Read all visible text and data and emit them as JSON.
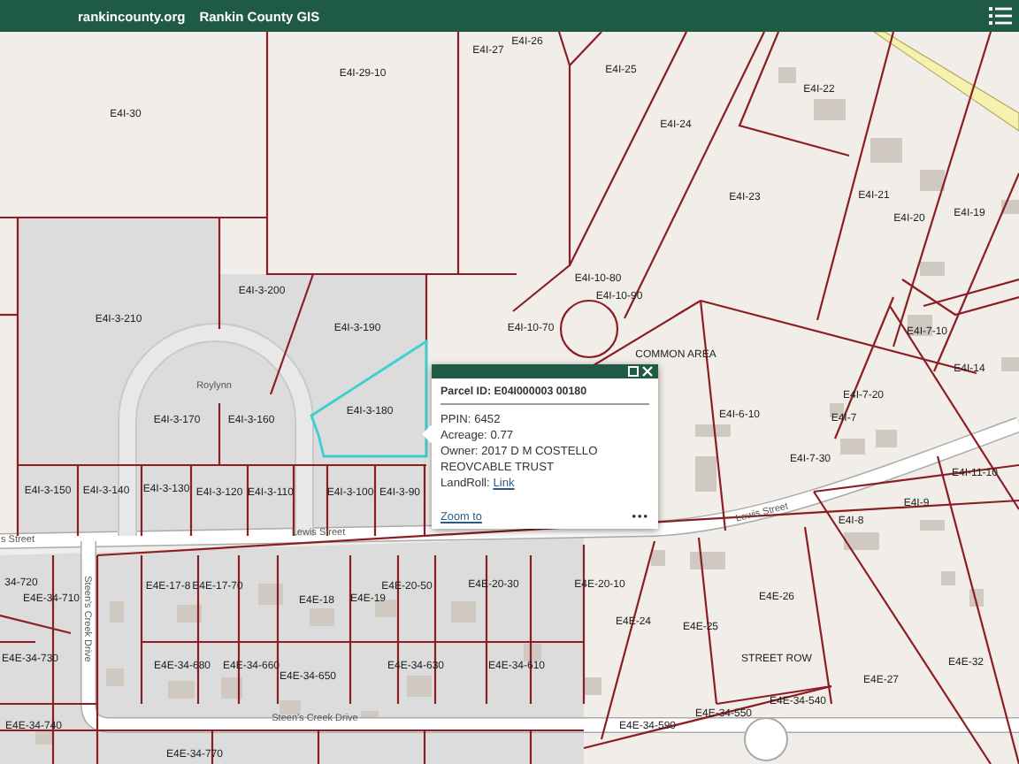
{
  "header": {
    "site": "rankincounty.org",
    "title": "Rankin County GIS"
  },
  "map": {
    "labels": [
      {
        "text": "E4I-30",
        "kind": "parcel"
      },
      {
        "text": "E4I-29-10",
        "kind": "parcel"
      },
      {
        "text": "E4I-27",
        "kind": "parcel"
      },
      {
        "text": "E4I-26",
        "kind": "parcel"
      },
      {
        "text": "E4I-25",
        "kind": "parcel"
      },
      {
        "text": "E4I-24",
        "kind": "parcel"
      },
      {
        "text": "E4I-22",
        "kind": "parcel"
      },
      {
        "text": "E4I-23",
        "kind": "parcel"
      },
      {
        "text": "E4I-21",
        "kind": "parcel"
      },
      {
        "text": "E4I-20",
        "kind": "parcel"
      },
      {
        "text": "E4I-19",
        "kind": "parcel"
      },
      {
        "text": "E4I-10-80",
        "kind": "parcel"
      },
      {
        "text": "E4I-10-90",
        "kind": "parcel"
      },
      {
        "text": "E4I-10-70",
        "kind": "parcel"
      },
      {
        "text": "COMMON AREA",
        "kind": "parcel"
      },
      {
        "text": "E4I-7-10",
        "kind": "parcel"
      },
      {
        "text": "E4I-14",
        "kind": "parcel"
      },
      {
        "text": "E4I-3-200",
        "kind": "parcel"
      },
      {
        "text": "E4I-3-210",
        "kind": "parcel"
      },
      {
        "text": "E4I-3-190",
        "kind": "parcel"
      },
      {
        "text": "Roylynn",
        "kind": "street"
      },
      {
        "text": "E4I-3-170",
        "kind": "parcel"
      },
      {
        "text": "E4I-3-160",
        "kind": "parcel"
      },
      {
        "text": "E4I-3-180",
        "kind": "parcel"
      },
      {
        "text": "E4I-3-150",
        "kind": "parcel"
      },
      {
        "text": "E4I-3-140",
        "kind": "parcel"
      },
      {
        "text": "E4I-3-130",
        "kind": "parcel"
      },
      {
        "text": "E4I-3-120",
        "kind": "parcel"
      },
      {
        "text": "E4I-3-110",
        "kind": "parcel"
      },
      {
        "text": "E4I-3-100",
        "kind": "parcel"
      },
      {
        "text": "E4I-3-90",
        "kind": "parcel"
      },
      {
        "text": "E4I-6-10",
        "kind": "parcel"
      },
      {
        "text": "E4I-7-20",
        "kind": "parcel"
      },
      {
        "text": "E4I-7",
        "kind": "parcel"
      },
      {
        "text": "E4I-7-30",
        "kind": "parcel"
      },
      {
        "text": "E4I-11-10",
        "kind": "parcel"
      },
      {
        "text": "E4I-9",
        "kind": "parcel"
      },
      {
        "text": "E4I-8",
        "kind": "parcel"
      },
      {
        "text": "s Street",
        "kind": "street"
      },
      {
        "text": "Lewis Street",
        "kind": "street"
      },
      {
        "text": "Lewis Street",
        "kind": "street"
      },
      {
        "text": "34-720",
        "kind": "parcel"
      },
      {
        "text": "E4E-34-710",
        "kind": "parcel"
      },
      {
        "text": "E4E-17-8",
        "kind": "parcel"
      },
      {
        "text": "E4E-17-70",
        "kind": "parcel"
      },
      {
        "text": "E4E-18",
        "kind": "parcel"
      },
      {
        "text": "E4E-19",
        "kind": "parcel"
      },
      {
        "text": "E4E-20-50",
        "kind": "parcel"
      },
      {
        "text": "E4E-20-30",
        "kind": "parcel"
      },
      {
        "text": "E4E-20-10",
        "kind": "parcel"
      },
      {
        "text": "E4E-24",
        "kind": "parcel"
      },
      {
        "text": "E4E-25",
        "kind": "parcel"
      },
      {
        "text": "E4E-26",
        "kind": "parcel"
      },
      {
        "text": "Steen's Creek Drive",
        "kind": "street"
      },
      {
        "text": "E4E-34-730",
        "kind": "parcel"
      },
      {
        "text": "E4E-34-680",
        "kind": "parcel"
      },
      {
        "text": "E4E-34-660",
        "kind": "parcel"
      },
      {
        "text": "E4E-34-650",
        "kind": "parcel"
      },
      {
        "text": "E4E-34-630",
        "kind": "parcel"
      },
      {
        "text": "E4E-34-610",
        "kind": "parcel"
      },
      {
        "text": "STREET ROW",
        "kind": "parcel"
      },
      {
        "text": "E4E-27",
        "kind": "parcel"
      },
      {
        "text": "E4E-32",
        "kind": "parcel"
      },
      {
        "text": "E4E-34-540",
        "kind": "parcel"
      },
      {
        "text": "E4E-34-550",
        "kind": "parcel"
      },
      {
        "text": "E4E-34-590",
        "kind": "parcel"
      },
      {
        "text": "E4E-34-740",
        "kind": "parcel"
      },
      {
        "text": "Steen's Creek Drive",
        "kind": "street"
      },
      {
        "text": "E4E-34-770",
        "kind": "parcel"
      }
    ]
  },
  "popup": {
    "title": "Parcel ID: E04I000003 00180",
    "fields": [
      {
        "kind": "text",
        "label": "PPIN:",
        "value": "6452"
      },
      {
        "kind": "text",
        "label": "Acreage:",
        "value": "0.77"
      },
      {
        "kind": "text",
        "label": "Owner:",
        "value": "2017 D M COSTELLO REOVCABLE TRUST"
      },
      {
        "kind": "link",
        "label": "LandRoll:",
        "value": "Link"
      }
    ],
    "zoom_link": "Zoom to",
    "more": "•••"
  }
}
